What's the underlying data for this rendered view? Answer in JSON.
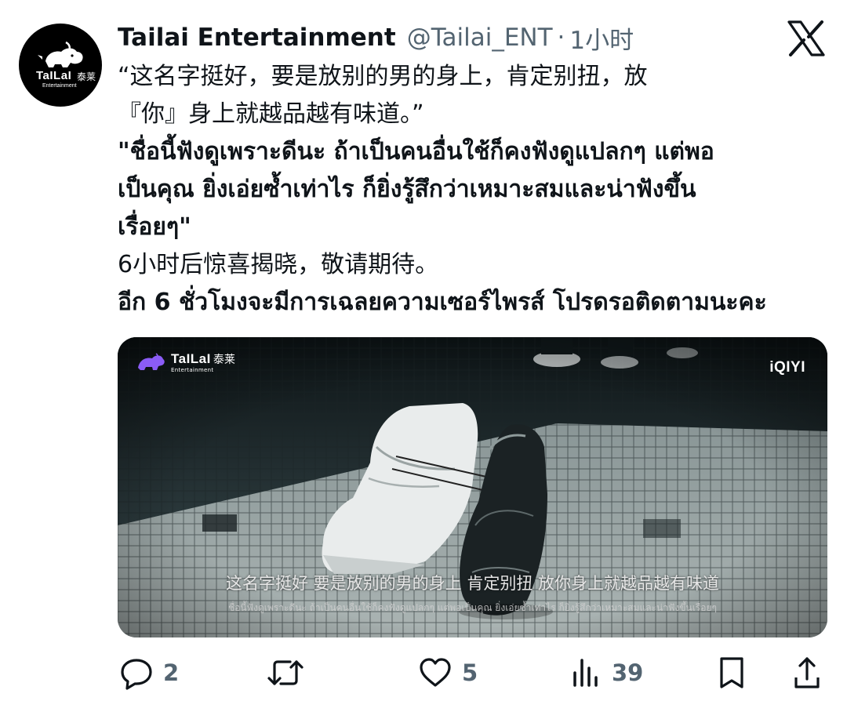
{
  "author": {
    "display_name": "Tailai Entertainment",
    "handle": "@Tailai_ENT",
    "separator": "·",
    "time": "1小时",
    "avatar": {
      "brand_text": "TaILaI",
      "brand_cn": "泰莱",
      "brand_sub": "Entertainment"
    }
  },
  "platform_icon": "x-logo-icon",
  "tweet": {
    "lines": [
      {
        "text": "“这名字挺好，要是放别的男的身上，肯定别扭，放",
        "lang": "zh"
      },
      {
        "text": "『你』身上就越品越有味道。”",
        "lang": "zh"
      },
      {
        "text": "\"ชื่อนี้ฟังดูเพราะดีนะ ถ้าเป็นคนอื่นใช้ก็คงฟังดูแปลกๆ แต่พอ",
        "lang": "th"
      },
      {
        "text": "เป็นคุณ ยิ่งเอ่ยซ้ำเท่าไร ก็ยิ่งรู้สึกว่าเหมาะสมและน่าฟังขึ้น",
        "lang": "th"
      },
      {
        "text": "เรื่อยๆ\"",
        "lang": "th"
      },
      {
        "text": "6小时后惊喜揭晓，敬请期待。",
        "lang": "zh"
      },
      {
        "text": "อีก 6 ชั่วโมงจะมีการเฉลยความเซอร์ไพรส์ โปรดรอติดตามนะคะ",
        "lang": "th"
      }
    ]
  },
  "media": {
    "brand_text": "TaILaI",
    "brand_cn": "泰莱",
    "brand_sub": "Entertainment",
    "watermark": "iQIYI",
    "subtitle_zh": "这名字挺好 要是放别的男的身上 肯定别扭 放你身上就越品越有味道",
    "subtitle_th": "ชื่อนี้ฟังดูเพราะดีนะ ถ้าเป็นคนอื่นใช้ก็คงฟังดูแปลกๆ แต่พอเป็นคุณ ยิ่งเอ่ยซ้ำเท่าไร ก็ยิ่งรู้สึกว่าเหมาะสมและน่าฟังขึ้นเรื่อยๆ"
  },
  "actions": {
    "reply": {
      "icon": "reply-icon",
      "count": "2"
    },
    "retweet": {
      "icon": "retweet-icon",
      "count": ""
    },
    "like": {
      "icon": "heart-icon",
      "count": "5"
    },
    "views": {
      "icon": "views-chart-icon",
      "count": "39"
    },
    "bookmark": {
      "icon": "bookmark-icon"
    },
    "share": {
      "icon": "share-icon"
    }
  },
  "colors": {
    "text_primary": "#0f1419",
    "text_secondary": "#536471",
    "avatar_bg": "#000000",
    "background": "#ffffff"
  }
}
